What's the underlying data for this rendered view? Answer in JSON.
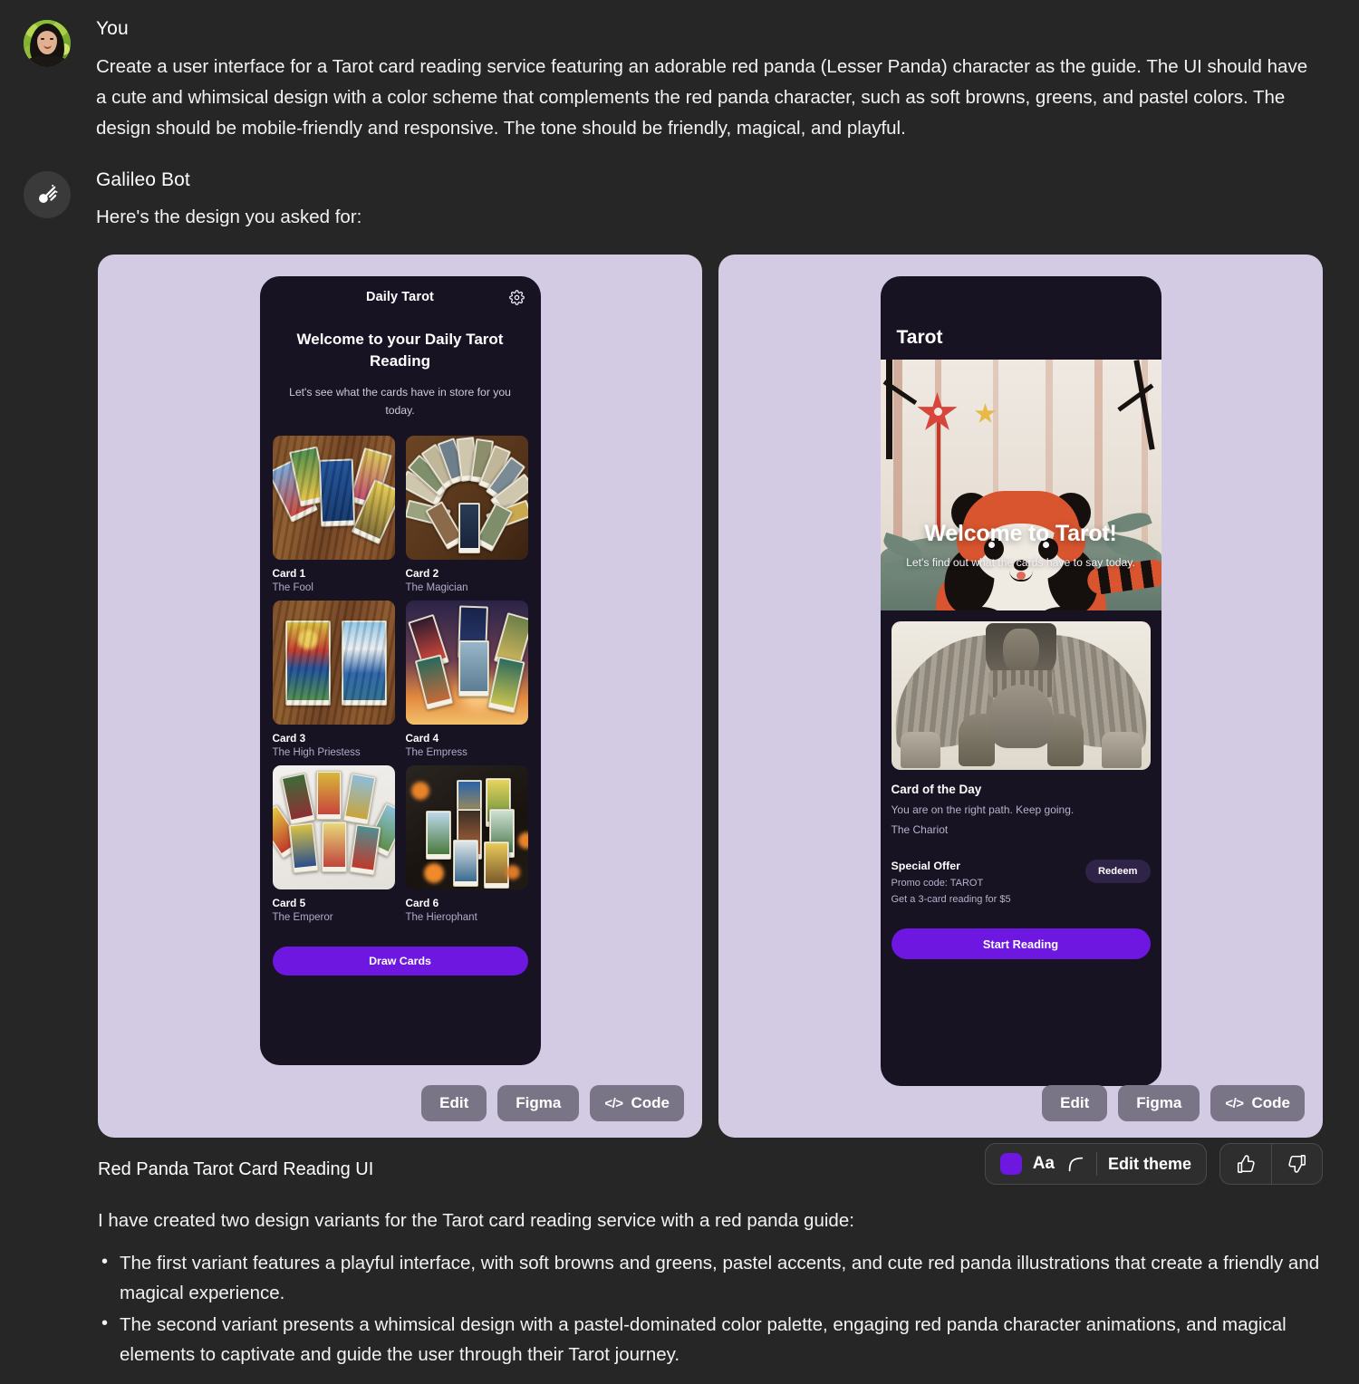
{
  "conversation": {
    "user": {
      "name": "You",
      "avatar_icon": "user-photo-avatar",
      "message": "Create a user interface for a Tarot card reading service featuring an adorable red panda (Lesser Panda) character as the guide. The UI should have a cute and whimsical design with a color scheme that complements the red panda character, such as soft browns, greens, and pastel colors. The design should be mobile-friendly and responsive. The tone should be friendly, magical, and playful."
    },
    "bot": {
      "name": "Galileo Bot",
      "avatar_icon": "comet-icon",
      "message": "Here's the design you asked for:"
    }
  },
  "variant_one": {
    "topbar": {
      "title": "Daily Tarot",
      "settings_icon": "gear-icon"
    },
    "headline": "Welcome to your Daily Tarot Reading",
    "subtitle": "Let's see what the cards have in store for you today.",
    "cards": [
      {
        "label": "Card 1",
        "name": "The Fool"
      },
      {
        "label": "Card 2",
        "name": "The Magician"
      },
      {
        "label": "Card 3",
        "name": "The High Priestess"
      },
      {
        "label": "Card 4",
        "name": "The Empress"
      },
      {
        "label": "Card 5",
        "name": "The Emperor"
      },
      {
        "label": "Card 6",
        "name": "The Hierophant"
      }
    ],
    "primary_button": "Draw Cards",
    "actions": {
      "edit": "Edit",
      "figma": "Figma",
      "code": "Code",
      "code_icon": "</>"
    }
  },
  "variant_two": {
    "topbar": {
      "title": "Tarot"
    },
    "hero": {
      "title": "Welcome to Tarot!",
      "subtitle": "Let's find out what the cards have to say today.",
      "illustration": "red-panda-with-star-wand"
    },
    "card_of_the_day": {
      "image": "winged-sphinx-statue",
      "title": "Card of the Day",
      "description": "You are on the right path. Keep going.",
      "card_name": "The Chariot"
    },
    "offer": {
      "title": "Special Offer",
      "promo_line": "Promo code: TAROT",
      "detail_line": "Get a 3-card reading for $5",
      "button": "Redeem"
    },
    "primary_button": "Start Reading",
    "actions": {
      "edit": "Edit",
      "figma": "Figma",
      "code": "Code",
      "code_icon": "</>"
    }
  },
  "footer": {
    "title": "Red Panda Tarot Card Reading UI",
    "intro": "I have created two design variants for the Tarot card reading service with a red panda guide:",
    "bullets": [
      "The first variant features a playful interface, with soft browns and greens, pastel accents, and cute red panda illustrations that create a friendly and magical experience.",
      "The second variant presents a whimsical design with a pastel-dominated color palette, engaging red panda character animations, and magical elements to captivate and guide the user through their Tarot journey."
    ]
  },
  "theme_bar": {
    "swatch_color": "#6d17e0",
    "typography_label": "Aa",
    "radius_icon": "corner-radius-icon",
    "edit_theme": "Edit theme",
    "thumbs_up_icon": "thumbs-up-icon",
    "thumbs_down_icon": "thumbs-down-icon"
  },
  "colors": {
    "app_background": "#262626",
    "panel_background": "#d3cbe4",
    "phone_background": "#171323",
    "accent": "#6d17e0",
    "muted_text": "#b3abc7"
  }
}
